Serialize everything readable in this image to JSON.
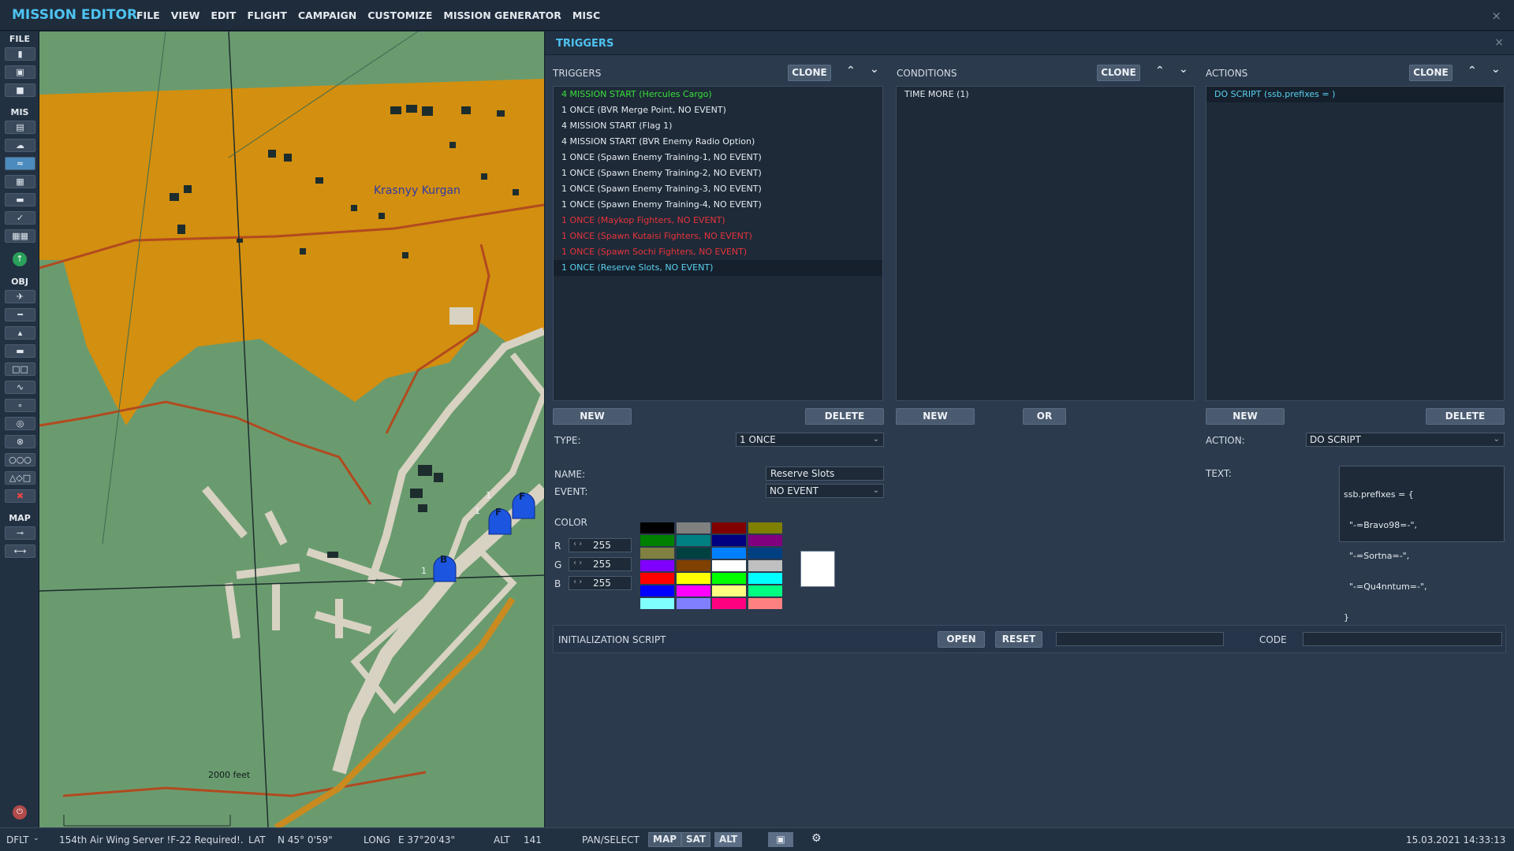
{
  "app": {
    "title": "MISSION EDITOR",
    "menu": [
      "FILE",
      "VIEW",
      "EDIT",
      "FLIGHT",
      "CAMPAIGN",
      "CUSTOMIZE",
      "MISSION GENERATOR",
      "MISC"
    ],
    "close_icon": "×"
  },
  "toolbar": {
    "file_label": "FILE",
    "mis_label": "MIS",
    "obj_label": "OBJ",
    "map_label": "MAP"
  },
  "map": {
    "town_label": "Krasnyy Kurgan",
    "scale_label": "2000 feet",
    "markers": [
      {
        "letter": "F",
        "count": "1"
      },
      {
        "letter": "F",
        "count": "1"
      },
      {
        "letter": "B",
        "count": "1"
      }
    ],
    "colors": {
      "grass": "#6a9b6f",
      "urban": "#d38f0f",
      "road": "#b24a1f",
      "runway": "#d8d2c2",
      "unit": "#1c55e0"
    }
  },
  "panel": {
    "title": "TRIGGERS",
    "close_icon": "×",
    "triggers": {
      "label": "TRIGGERS",
      "clone": "CLONE",
      "new": "NEW",
      "delete": "DELETE",
      "items": [
        {
          "text": "4 MISSION START (Hercules Cargo)",
          "color": "#38e038"
        },
        {
          "text": "1 ONCE (BVR Merge Point, NO EVENT)",
          "color": "#e6ebf0"
        },
        {
          "text": "4 MISSION START (Flag 1)",
          "color": "#e6ebf0"
        },
        {
          "text": "4 MISSION START (BVR Enemy Radio Option)",
          "color": "#e6ebf0"
        },
        {
          "text": "1 ONCE (Spawn Enemy Training-1, NO EVENT)",
          "color": "#e6ebf0"
        },
        {
          "text": "1 ONCE (Spawn Enemy Training-2, NO EVENT)",
          "color": "#e6ebf0"
        },
        {
          "text": "1 ONCE (Spawn Enemy Training-3, NO EVENT)",
          "color": "#e6ebf0"
        },
        {
          "text": "1 ONCE (Spawn Enemy Training-4, NO EVENT)",
          "color": "#e6ebf0"
        },
        {
          "text": "1 ONCE (Maykop Fighters, NO EVENT)",
          "color": "#e8333a"
        },
        {
          "text": "1 ONCE (Spawn Kutaisi Fighters, NO EVENT)",
          "color": "#e8333a"
        },
        {
          "text": "1 ONCE (Spawn Sochi Fighters, NO EVENT)",
          "color": "#e8333a"
        },
        {
          "text": "1 ONCE (Reserve Slots, NO EVENT)",
          "color": "#5ad0f0"
        }
      ],
      "selected_index": 11
    },
    "conditions": {
      "label": "CONDITIONS",
      "clone": "CLONE",
      "new": "NEW",
      "or": "OR",
      "items": [
        "TIME MORE (1)"
      ]
    },
    "actions": {
      "label": "ACTIONS",
      "clone": "CLONE",
      "new": "NEW",
      "delete": "DELETE",
      "items": [
        "DO SCRIPT (ssb.prefixes = )"
      ],
      "action_label": "ACTION:",
      "action_value": "DO SCRIPT",
      "text_label": "TEXT:",
      "text_lines": [
        "ssb.prefixes = {",
        "  \"-=Bravo98=-\",",
        "  \"-=Sortna=-\",",
        "  \"-=Qu4nntum=-\",",
        "}"
      ]
    },
    "type_label": "TYPE:",
    "type_value": "1 ONCE",
    "name_label": "NAME:",
    "name_value": "Reserve Slots",
    "event_label": "EVENT:",
    "event_value": "NO EVENT",
    "color": {
      "label": "COLOR",
      "r_label": "R",
      "r": "255",
      "g_label": "G",
      "g": "255",
      "b_label": "B",
      "b": "255",
      "preview": "#ffffff",
      "palette": [
        "#000000",
        "#808080",
        "#800000",
        "#808000",
        "#008000",
        "#008080",
        "#000080",
        "#800080",
        "#808040",
        "#004040",
        "#0080ff",
        "#004080",
        "#8000ff",
        "#804000",
        "#ffffff",
        "#c0c0c0",
        "#ff0000",
        "#ffff00",
        "#00ff00",
        "#00ffff",
        "#0000ff",
        "#ff00ff",
        "#ffff80",
        "#00ff80",
        "#80ffff",
        "#8080ff",
        "#ff0080",
        "#ff8080"
      ]
    },
    "init_script": {
      "label": "INITIALIZATION SCRIPT",
      "open": "OPEN",
      "reset": "RESET",
      "code_label": "CODE"
    }
  },
  "status": {
    "layout": "DFLT",
    "server": "154th Air Wing Server !F-22 Required!.",
    "lat_label": "LAT",
    "lat": "N 45° 0'59\"",
    "long_label": "LONG",
    "long": "E 37°20'43\"",
    "alt_label": "ALT",
    "alt": "141",
    "pan_select": "PAN/SELECT",
    "map_btn": "MAP",
    "sat_btn": "SAT",
    "alt_btn": "ALT",
    "datetime": "15.03.2021 14:33:13"
  }
}
